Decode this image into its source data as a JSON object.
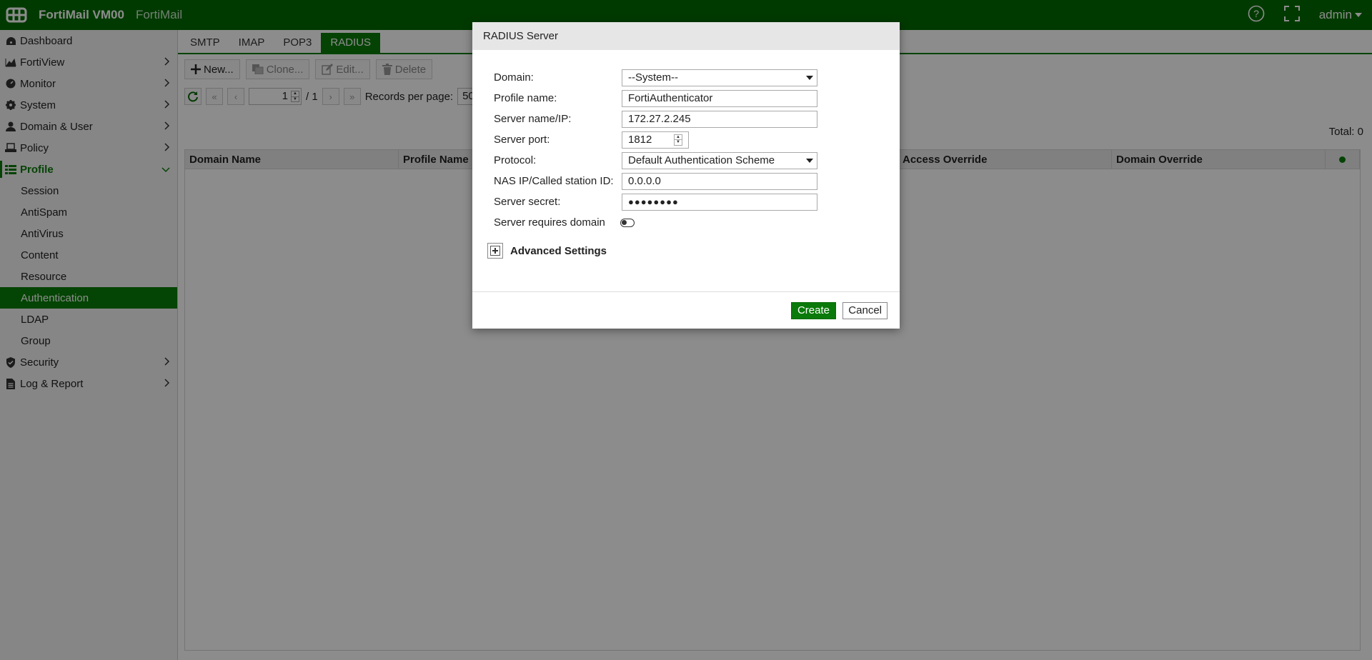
{
  "header": {
    "app_name": "FortiMail VM00",
    "host_name": "FortiMail",
    "user": "admin",
    "brand_color": "#036b03"
  },
  "sidebar": {
    "items": [
      {
        "label": "Dashboard",
        "icon": "dashboard-icon"
      },
      {
        "label": "FortiView",
        "icon": "chart-icon"
      },
      {
        "label": "Monitor",
        "icon": "monitor-icon"
      },
      {
        "label": "System",
        "icon": "gear-icon"
      },
      {
        "label": "Domain & User",
        "icon": "user-icon"
      },
      {
        "label": "Policy",
        "icon": "policy-icon"
      },
      {
        "label": "Profile",
        "icon": "list-icon"
      },
      {
        "label": "Session"
      },
      {
        "label": "AntiSpam"
      },
      {
        "label": "AntiVirus"
      },
      {
        "label": "Content"
      },
      {
        "label": "Resource"
      },
      {
        "label": "Authentication"
      },
      {
        "label": "LDAP"
      },
      {
        "label": "Group"
      },
      {
        "label": "Security",
        "icon": "shield-icon"
      },
      {
        "label": "Log & Report",
        "icon": "report-icon"
      }
    ]
  },
  "tabs": [
    "SMTP",
    "IMAP",
    "POP3",
    "RADIUS"
  ],
  "toolbar": {
    "new": "New...",
    "clone": "Clone...",
    "edit": "Edit...",
    "delete": "Delete"
  },
  "pager": {
    "page": "1",
    "of": "/ 1",
    "records_label": "Records per page:",
    "records_value": "50",
    "total": "Total: 0"
  },
  "table": {
    "columns": [
      "Domain Name",
      "Profile Name",
      "Access Override",
      "Domain Override"
    ]
  },
  "dialog": {
    "title": "RADIUS Server",
    "fields": {
      "domain_label": "Domain:",
      "domain_value": "--System--",
      "profile_label": "Profile name:",
      "profile_value": "FortiAuthenticator",
      "server_label": "Server name/IP:",
      "server_value": "172.27.2.245",
      "port_label": "Server port:",
      "port_value": "1812",
      "protocol_label": "Protocol:",
      "protocol_value": "Default Authentication Scheme",
      "nas_label": "NAS IP/Called station ID:",
      "nas_value": "0.0.0.0",
      "secret_label": "Server secret:",
      "secret_value": "●●●●●●●●",
      "requires_domain_label": "Server requires domain",
      "requires_domain": false
    },
    "advanced": "Advanced Settings",
    "create": "Create",
    "cancel": "Cancel"
  }
}
